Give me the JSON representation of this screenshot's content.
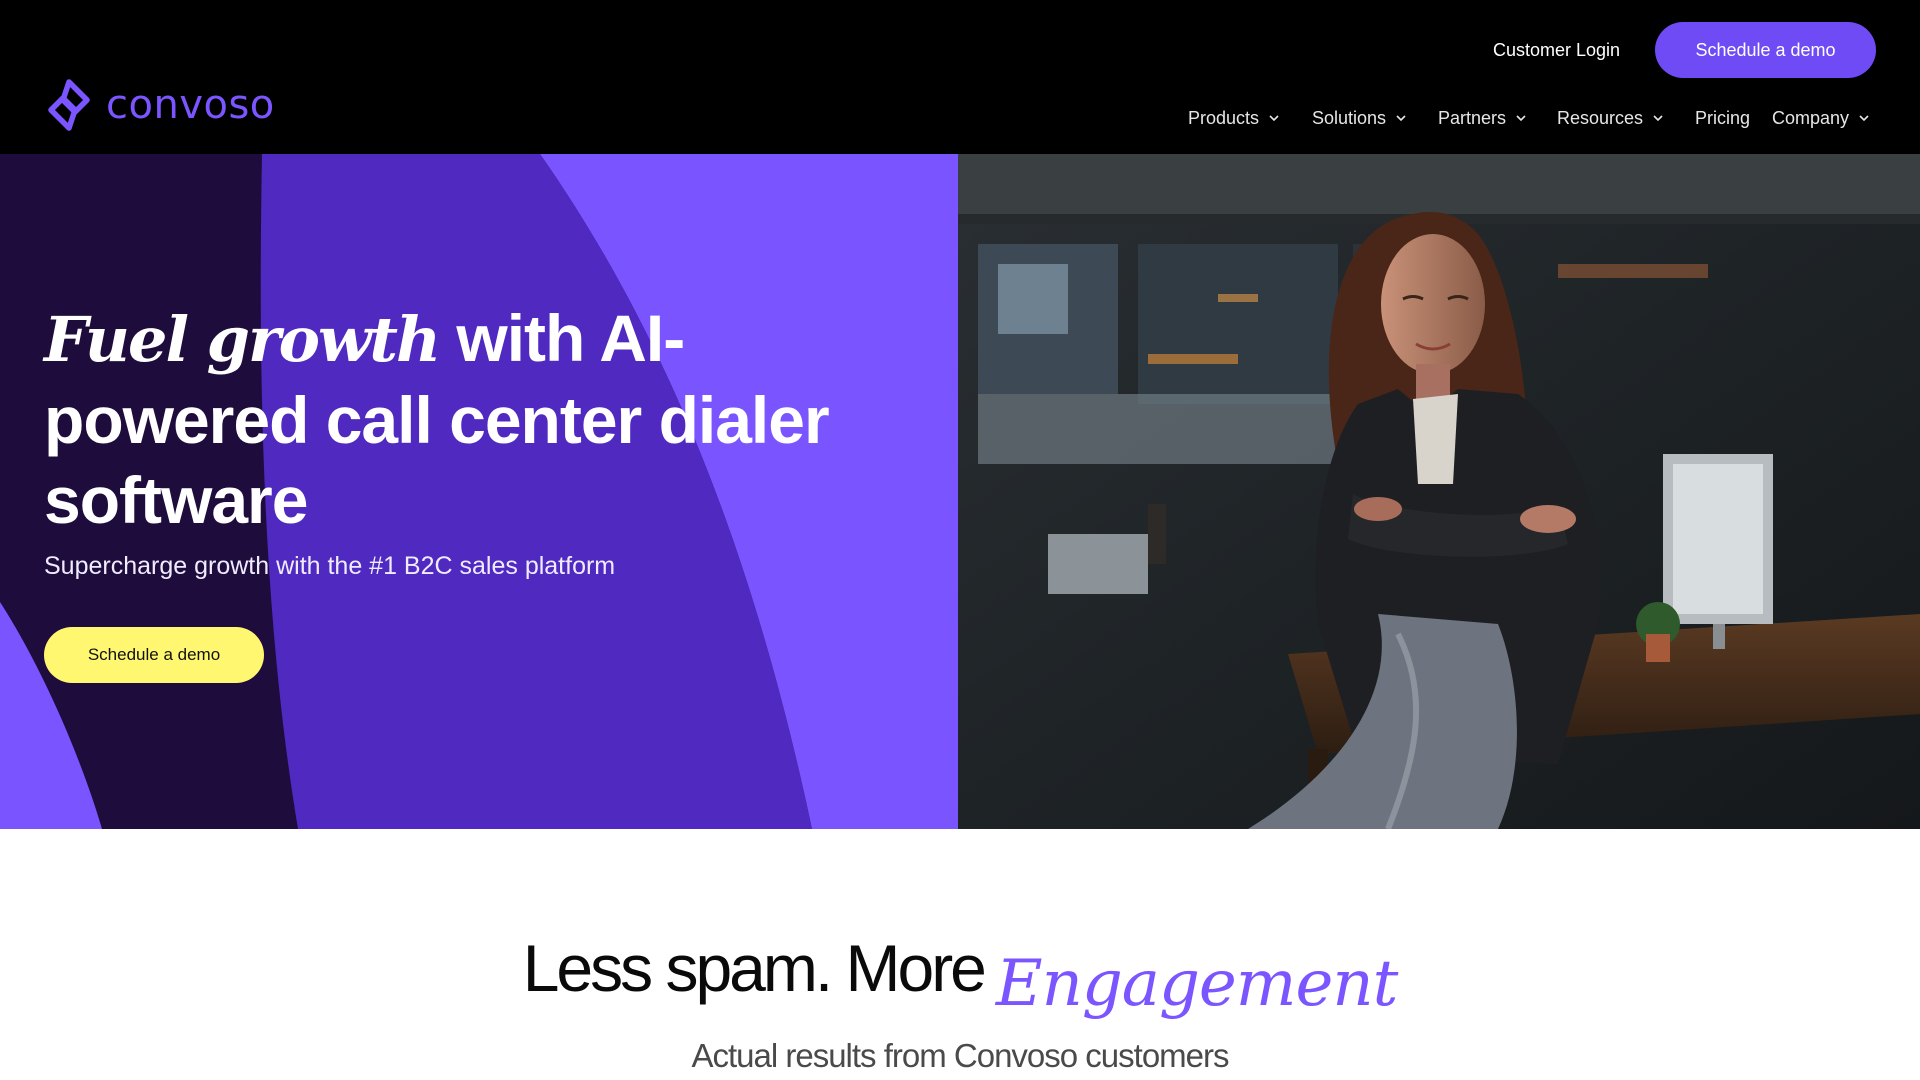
{
  "brand": {
    "name": "convoso",
    "logo_color": "#7b55ff"
  },
  "header": {
    "customer_login": "Customer Login",
    "demo_button": "Schedule a demo",
    "nav": [
      {
        "label": "Products",
        "has_dropdown": true
      },
      {
        "label": "Solutions",
        "has_dropdown": true
      },
      {
        "label": "Partners",
        "has_dropdown": true
      },
      {
        "label": "Resources",
        "has_dropdown": true
      },
      {
        "label": "Pricing",
        "has_dropdown": false
      },
      {
        "label": "Company",
        "has_dropdown": true
      }
    ],
    "icons": {
      "dropdown": "chevron-down-icon"
    }
  },
  "hero": {
    "title_italic": "Fuel growth",
    "title_rest": " with AI-powered call center dialer software",
    "subtitle": "Supercharge growth with the #1 B2C sales platform",
    "demo_button": "Schedule a demo",
    "photo": "woman-arms-crossed-in-office-photo"
  },
  "results": {
    "heading_plain": "Less spam. More",
    "heading_accent": "Engagement",
    "subheading": "Actual results from Convoso customers"
  },
  "colors": {
    "header_bg": "#000000",
    "primary_purple": "#6e4bf5",
    "accent_purple": "#7b55ff",
    "deep_purple": "#4f2abf",
    "dark_purple": "#1e0c3c",
    "cta_yellow": "#fff770"
  }
}
